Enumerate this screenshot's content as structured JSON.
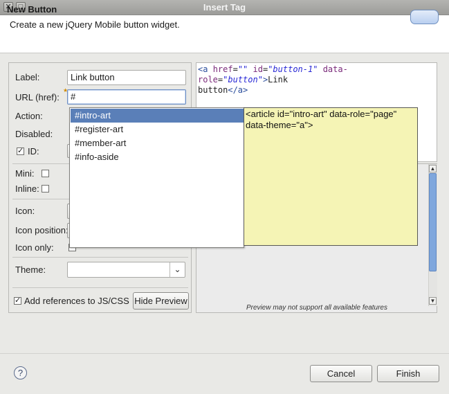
{
  "window": {
    "title": "Insert Tag",
    "close_glyph": "✕",
    "menu_glyph": "□"
  },
  "header": {
    "title": "New Button",
    "description": "Create a new jQuery Mobile button widget."
  },
  "form": {
    "label_label": "Label:",
    "label_value": "Link button",
    "url_label": "URL (href):",
    "url_value": "#",
    "action_label": "Action:",
    "disabled_label": "Disabled:",
    "id_label": "ID:",
    "mini_label": "Mini:",
    "inline_label": "Inline:",
    "icon_label": "Icon:",
    "icon_position_label": "Icon position:",
    "icon_only_label": "Icon only:",
    "theme_label": "Theme:",
    "theme_value": "",
    "add_refs_label": "Add references to JS/CSS",
    "hide_preview_label": "Hide Preview"
  },
  "code": {
    "line1": [
      {
        "cls": "tag",
        "text": "<a "
      },
      {
        "cls": "attr",
        "text": "href"
      },
      {
        "cls": "txt",
        "text": "="
      },
      {
        "cls": "val",
        "text": "\"\""
      },
      {
        "cls": "txt",
        "text": " "
      },
      {
        "cls": "attr",
        "text": "id"
      },
      {
        "cls": "txt",
        "text": "="
      },
      {
        "cls": "val",
        "text": "\"button-1\""
      },
      {
        "cls": "txt",
        "text": " "
      },
      {
        "cls": "attr",
        "text": "data-role"
      },
      {
        "cls": "txt",
        "text": "="
      },
      {
        "cls": "val",
        "text": "\"button\""
      },
      {
        "cls": "tag",
        "text": ">"
      },
      {
        "cls": "txt",
        "text": "Link"
      }
    ],
    "line2": [
      {
        "cls": "txt",
        "text": "button"
      },
      {
        "cls": "tag",
        "text": "</a>"
      }
    ]
  },
  "autocomplete": {
    "items": [
      "#intro-art",
      "#register-art",
      "#member-art",
      "#info-aside"
    ],
    "selected_index": 0,
    "tooltip": "<article id=\"intro-art\" data-role=\"page\" data-theme=\"a\">"
  },
  "preview": {
    "note": "Preview may not support all available features"
  },
  "footer": {
    "help_glyph": "?",
    "cancel_label": "Cancel",
    "finish_label": "Finish"
  },
  "colors": {
    "selection": "#5a7fb8",
    "tooltip_bg": "#f5f4b5"
  }
}
